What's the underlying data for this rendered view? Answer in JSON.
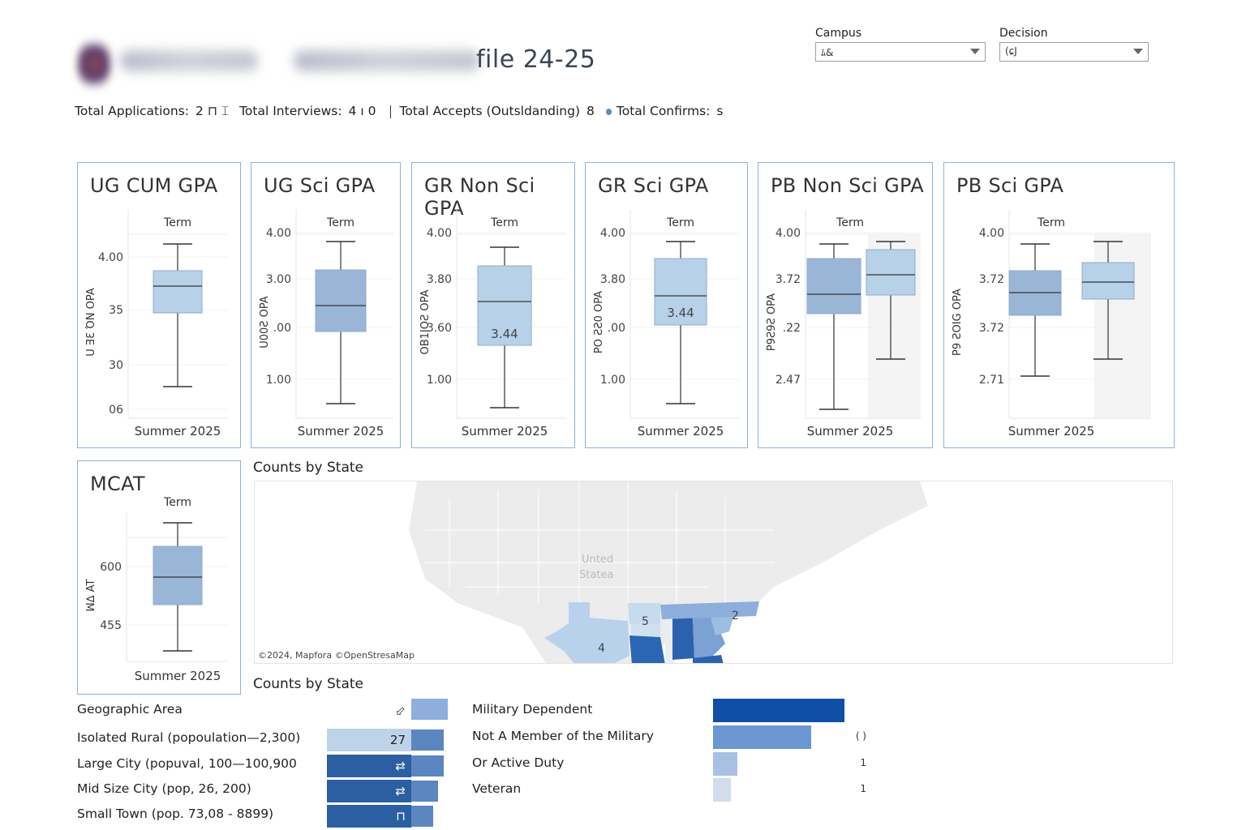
{
  "header": {
    "title": "file 24-25",
    "logo_icon": "school-logo-icon"
  },
  "filters": {
    "campus": {
      "label": "Campus",
      "value": "ﾑ&"
    },
    "decision": {
      "label": "Decision",
      "value": "(ɕJ"
    }
  },
  "kpis": {
    "applications_label": "Total Applications:",
    "applications_value": "2 ⊓ ⌶",
    "interviews_label": "Total Interviews:",
    "interviews_value": "4 ı 0",
    "accepts_label": "Total Accepts (Outsldanding)",
    "accepts_value": "8",
    "confirms_label": "Total Confirms:",
    "confirms_value": "s"
  },
  "colors": {
    "card_border": "#8fb2d4",
    "box_light": "#b7d1e8",
    "box_mid": "#9ab6d6",
    "map_dark": "#1f5aa6",
    "bar_dark": "#2b5fa2",
    "bar_light": "#bcd3ea"
  },
  "cards": [
    {
      "title": "UG CUM GPA",
      "term_label": "Term",
      "x_label": "Summer 2025",
      "y_title": "U ƎƐ ΌN ΟPA",
      "y_ticks": [
        "4.00",
        "35",
        "30",
        "06"
      ],
      "box_label": ""
    },
    {
      "title": "UG Sci GPA",
      "term_label": "Term",
      "x_label": "Summer 2025",
      "y_title": "U00Ƨ ΟPA",
      "y_ticks": [
        "4.00",
        "3.00",
        ".00",
        "1.00"
      ],
      "box_label": ""
    },
    {
      "title": "GR Non Sci GPA",
      "term_label": "Term",
      "x_label": "Summer 2025",
      "y_title": "ΟB1IOƧ ΟPA",
      "y_ticks": [
        "4.00",
        "3.80",
        "3.60",
        "1.00"
      ],
      "box_label": "3.44"
    },
    {
      "title": "GR Sci GPA",
      "term_label": "Term",
      "x_label": "Summer 2025",
      "y_title": "PO ƧƧ0 ΟPA",
      "y_ticks": [
        "4.00",
        "3.80",
        ".00",
        "1.00"
      ],
      "box_label": "3.44"
    },
    {
      "title": "PB Non Sci GPA",
      "term_label": "Term",
      "x_label": "Summer 2025",
      "y_title": "P9Ƨ9Ƨ ΟPA",
      "y_ticks": [
        "4.00",
        "3.72",
        ".22",
        "2.47"
      ],
      "box_label": ""
    },
    {
      "title": "PB Sci GPA",
      "term_label": "Term",
      "x_label": "Summer 2025",
      "y_title": "P9 ƧOIG ΟPA",
      "y_ticks": [
        "4.00",
        "3.72",
        "3.72",
        "2.71"
      ],
      "box_label": ""
    },
    {
      "title": "MCAT",
      "term_label": "Term",
      "x_label": "Summer 2025",
      "y_title": "ꟽ∆ AT",
      "y_ticks": [
        "600",
        "455"
      ],
      "box_label": ""
    }
  ],
  "map": {
    "section_title": "Counts by State",
    "country_label_1": "Unted",
    "country_label_2": "Statea",
    "credit": "©2024, Mapfora ©OpenStresaMap",
    "state_labels": {
      "tx": "4",
      "al": "5",
      "nc": "2"
    }
  },
  "bottom": {
    "section_title": "Counts by State",
    "geo_header": "Geographic Area",
    "geo_rows": [
      {
        "label": "Isolated Rural (popoulation—2,300)",
        "value": "27"
      },
      {
        "label": "Large City (popuval, 100—100,900",
        "value": "⇄"
      },
      {
        "label": "Mid Size City (pop, 26, 200)",
        "value": "⇄"
      },
      {
        "label": "Small Town (pop. 73,08 - 8899)",
        "value": "⊓"
      }
    ],
    "military_rows": [
      {
        "label": "Military Dependent",
        "value": ""
      },
      {
        "label": "Not A Member of the Military",
        "value": "( )"
      },
      {
        "label": "Or Active Duty",
        "value": "1"
      },
      {
        "label": "Veteran",
        "value": "1"
      }
    ],
    "geo_header_value": "⬃"
  }
}
